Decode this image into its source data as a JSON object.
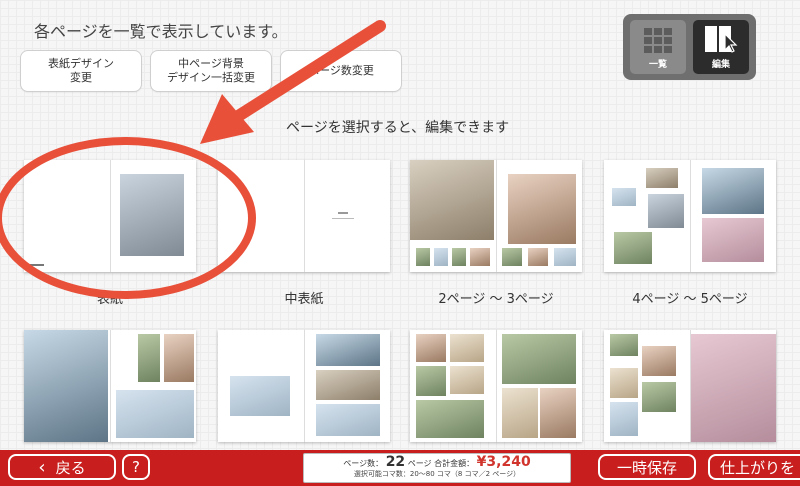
{
  "header": {
    "text": "各ページを一覧で表示しています。"
  },
  "buttons": {
    "cover_design": {
      "line1": "表紙デザイン",
      "line2": "変更"
    },
    "inner_bg": {
      "line1": "中ページ背景",
      "line2": "デザイン一括変更"
    },
    "page_count": {
      "label": "ページ数変更"
    }
  },
  "view_toggle": {
    "list_label": "一覧",
    "edit_label": "編集"
  },
  "instruction": "ページを選択すると、編集できます",
  "spreads": [
    {
      "label": "表紙"
    },
    {
      "label": "中表紙"
    },
    {
      "label": "2ページ ～ 3ページ"
    },
    {
      "label": "4ページ ～ 5ページ"
    }
  ],
  "bottom_bar": {
    "back_label": "戻る",
    "help_label": "?",
    "save_label": "一時保存",
    "finish_label": "仕上がりを",
    "summary": {
      "pages_prefix": "ページ数：",
      "pages_value": "22",
      "pages_unit": "ページ",
      "total_prefix": "合計金額：",
      "price": "¥3,240",
      "line2": "選択可能コマ数：20～80 コマ（8 コマ／2 ページ）"
    }
  },
  "colors": {
    "accent": "#c81e1e",
    "price": "#d0342c",
    "annotation": "#e8503a"
  }
}
